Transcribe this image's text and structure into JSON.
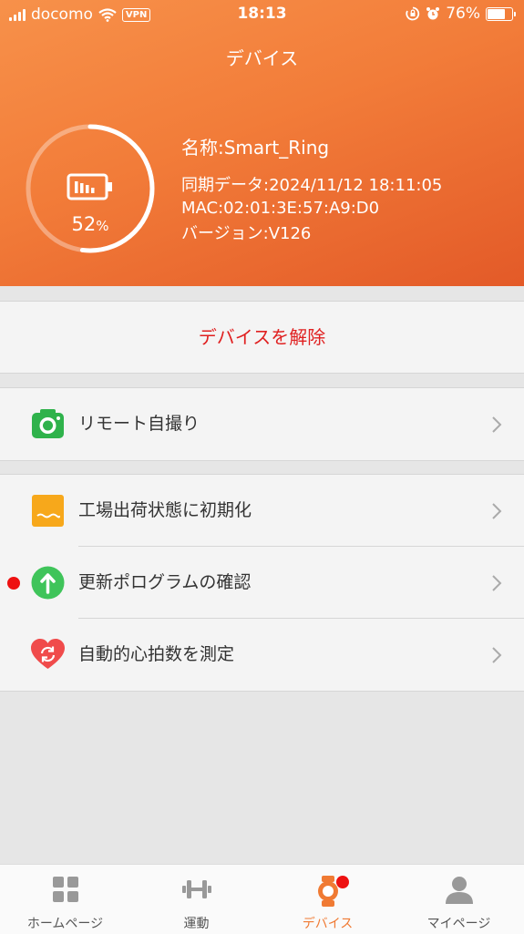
{
  "status_bar": {
    "carrier": "docomo",
    "vpn": "VPN",
    "time": "18:13",
    "battery": "76%",
    "battery_level": 0.76
  },
  "header": {
    "title": "デバイス",
    "battery_percent": "52",
    "battery_unit": "%",
    "battery_level": 0.52,
    "device_name": "名称:Smart_Ring",
    "sync_data": "同期データ:2024/11/12 18:11:05",
    "mac": "MAC:02:01:3E:57:A9:D0",
    "version": "バージョン:V126"
  },
  "unbind_label": "デバイスを解除",
  "menu": {
    "remote_selfie": "リモート自撮り",
    "factory_reset": "工場出荷状態に初期化",
    "firmware_check": "更新ポログラムの確認",
    "auto_heart_rate": "自動的心拍数を測定"
  },
  "tabs": [
    {
      "label": "ホームページ",
      "icon": "home-grid-icon"
    },
    {
      "label": "運動",
      "icon": "dumbbell-icon"
    },
    {
      "label": "デバイス",
      "icon": "watch-icon"
    },
    {
      "label": "マイページ",
      "icon": "person-icon"
    }
  ],
  "colors": {
    "accent": "#f07a33",
    "danger": "#e02020",
    "header_start": "#f7914a",
    "header_end": "#e35a28"
  }
}
